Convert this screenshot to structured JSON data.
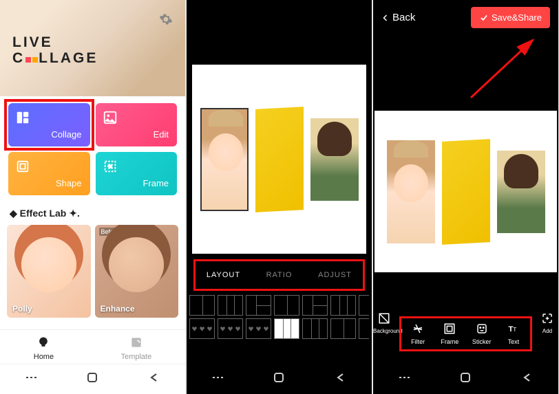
{
  "screen1": {
    "logo_line1": "LIVE",
    "logo_line2_a": "C",
    "logo_line2_b": "LLAGE",
    "tiles": {
      "collage": "Collage",
      "edit": "Edit",
      "shape": "Shape",
      "frame": "Frame"
    },
    "section_label": "◆ Effect Lab ✦.",
    "effects": {
      "polly": "Polly",
      "enhance": "Enhance",
      "before_tag": "Before"
    },
    "tabs": {
      "home": "Home",
      "template": "Template"
    }
  },
  "screen2": {
    "tabs": {
      "layout": "LAYOUT",
      "ratio": "RATIO",
      "adjust": "ADJUST"
    }
  },
  "screen3": {
    "back": "Back",
    "save": "Save&Share",
    "tools": {
      "background": "Background",
      "filter": "Filter",
      "frame": "Frame",
      "sticker": "Sticker",
      "text": "Text",
      "add": "Add"
    }
  }
}
